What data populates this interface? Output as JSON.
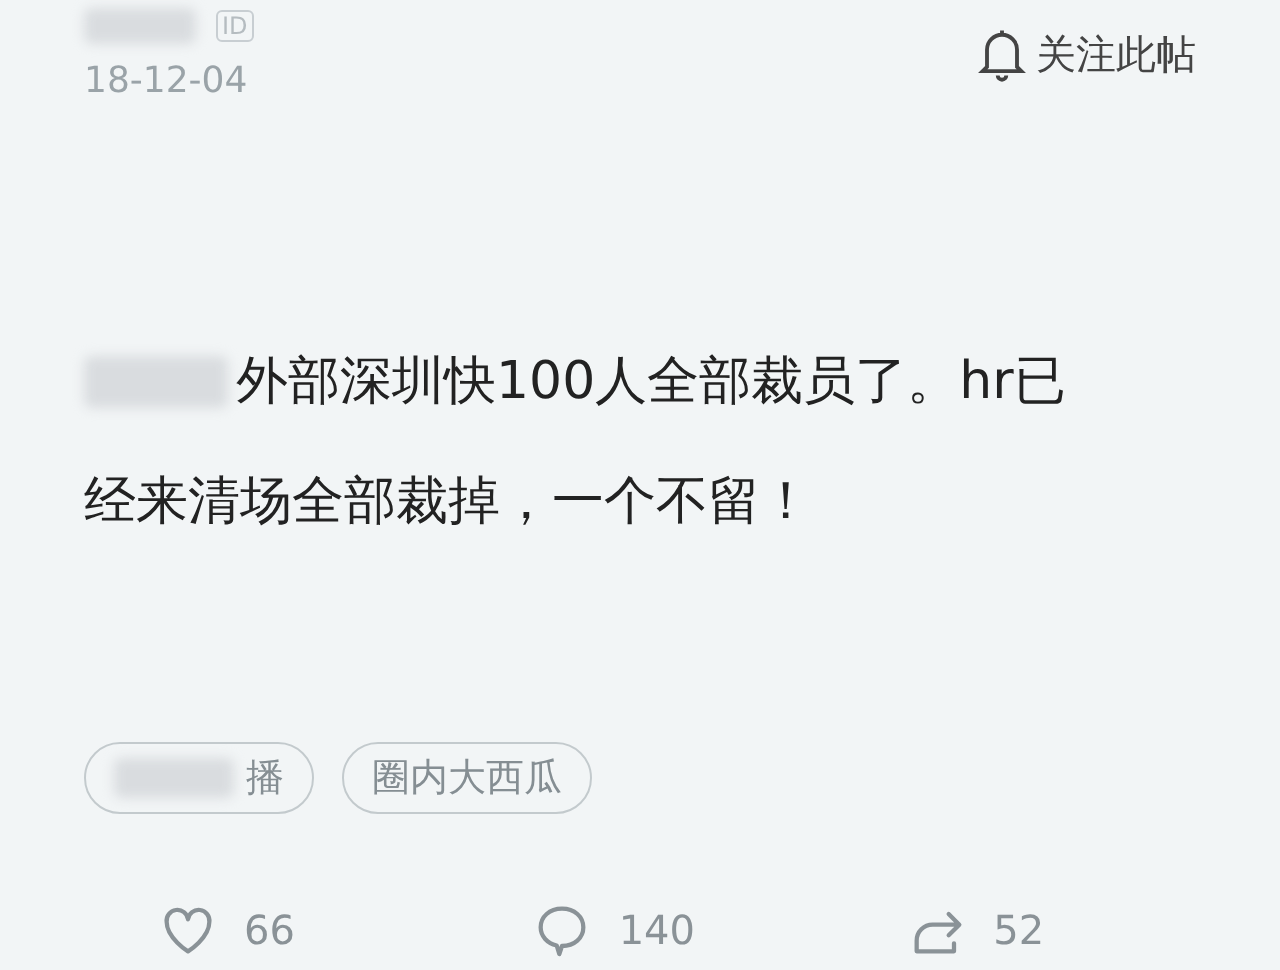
{
  "post": {
    "badge": "ID",
    "date": "18-12-04",
    "follow_label": "关注此帖",
    "body_lines": [
      "外部深圳快100人全部裁员了。hr已",
      "经来清场全部裁掉，一个不留！"
    ],
    "tags": [
      {
        "label": "播",
        "redacted": true
      },
      {
        "label": "圈内大西瓜",
        "redacted": false
      }
    ],
    "actions": [
      {
        "kind": "like",
        "count": "66"
      },
      {
        "kind": "comment",
        "count": "140"
      },
      {
        "kind": "share",
        "count": "52"
      }
    ]
  }
}
